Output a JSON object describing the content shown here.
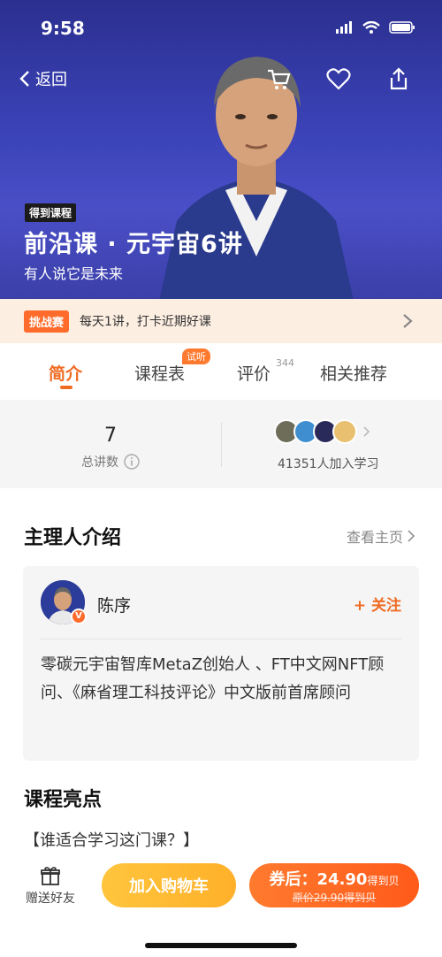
{
  "status_bar": {
    "time": "9:58"
  },
  "nav": {
    "back_label": "返回",
    "icons": [
      "cart-icon",
      "heart-icon",
      "share-icon"
    ]
  },
  "hero": {
    "badge": "得到课程",
    "title": "前沿课 · 元宇宙6讲",
    "subtitle": "有人说它是未来"
  },
  "challenge": {
    "tag": "挑战赛",
    "text": "每天1讲，打卡近期好课"
  },
  "tabs": [
    {
      "label": "简介",
      "active": true
    },
    {
      "label": "课程表",
      "badge": "试听"
    },
    {
      "label": "评价",
      "count": "344"
    },
    {
      "label": "相关推荐"
    }
  ],
  "stats": {
    "lessons_value": "7",
    "lessons_label": "总讲数",
    "learners_label": "41351人加入学习"
  },
  "host_section": {
    "title": "主理人介绍",
    "view_home": "查看主页"
  },
  "host": {
    "name": "陈序",
    "follow_label": "关注",
    "description": "零碳元宇宙智库MetaZ创始人 、FT中文网NFT顾问、《麻省理工科技评论》中文版前首席顾问"
  },
  "highlights": {
    "title": "课程亮点",
    "question": "【谁适合学习这门课？】"
  },
  "bottom_bar": {
    "gift_label": "赠送好友",
    "cart_label": "加入购物车",
    "price_prefix": "券后：",
    "price": "24.90",
    "price_unit": "得到贝",
    "original_price": "原价29.90得到贝"
  },
  "colors": {
    "accent": "#f06b22",
    "hero_bg": "#3b43b8",
    "challenge_bg": "#fdeee2"
  }
}
